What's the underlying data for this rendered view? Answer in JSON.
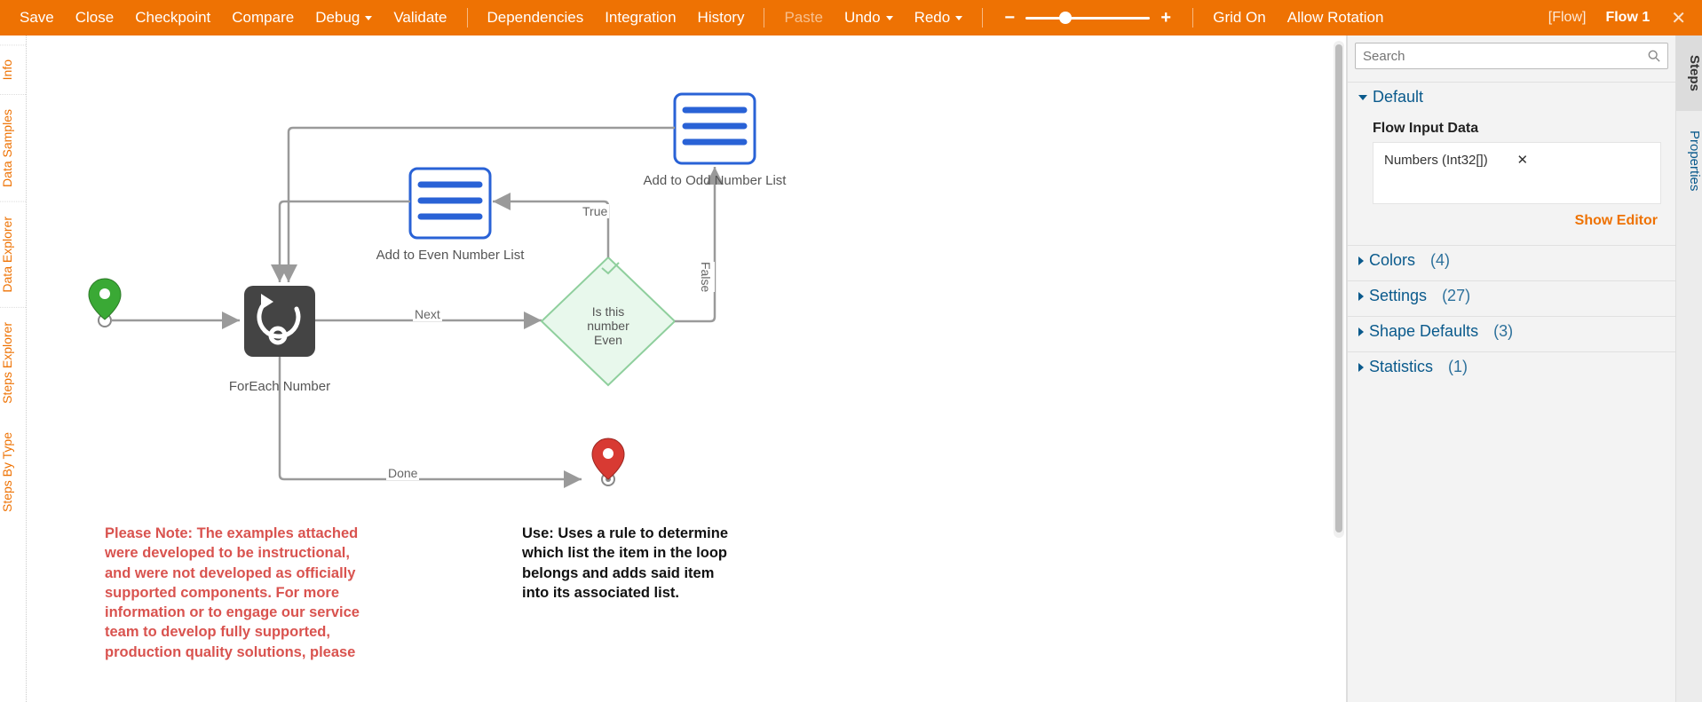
{
  "toolbar": {
    "save": "Save",
    "close": "Close",
    "checkpoint": "Checkpoint",
    "compare": "Compare",
    "debug": "Debug",
    "validate": "Validate",
    "dependencies": "Dependencies",
    "integration": "Integration",
    "history": "History",
    "paste": "Paste",
    "undo": "Undo",
    "redo": "Redo",
    "grid_on": "Grid On",
    "allow_rotation": "Allow Rotation",
    "flow_type": "[Flow]",
    "flow_name": "Flow 1"
  },
  "left_tabs": {
    "info": "Info",
    "data_samples": "Data Samples",
    "data_explorer": "Data Explorer",
    "steps_explorer": "Steps Explorer",
    "steps_by_type": "Steps By Type"
  },
  "canvas": {
    "foreach_label": "ForEach Number",
    "even_label": "Add to Even Number List",
    "odd_label": "Add to Odd Number List",
    "decision_line1": "Is this",
    "decision_line2": "number",
    "decision_line3": "Even",
    "edge_next": "Next",
    "edge_done": "Done",
    "edge_true": "True",
    "edge_false": "False",
    "note_red": "Please Note: The examples attached were developed to be instructional, and were not developed as officially supported components.  For more information or to engage our service team to develop fully supported, production quality solutions, please",
    "note_black": "Use: Uses a rule to determine which list the item in the loop belongs and adds said item into its associated list."
  },
  "right": {
    "search_placeholder": "Search",
    "default_group": "Default",
    "flow_input_title": "Flow Input Data",
    "input_item": "Numbers (Int32[])",
    "show_editor": "Show Editor",
    "colors_label": "Colors",
    "colors_count": "(4)",
    "settings_label": "Settings",
    "settings_count": "(27)",
    "shape_defaults_label": "Shape Defaults",
    "shape_defaults_count": "(3)",
    "statistics_label": "Statistics",
    "statistics_count": "(1)"
  },
  "right_tabs": {
    "steps": "Steps",
    "properties": "Properties"
  }
}
